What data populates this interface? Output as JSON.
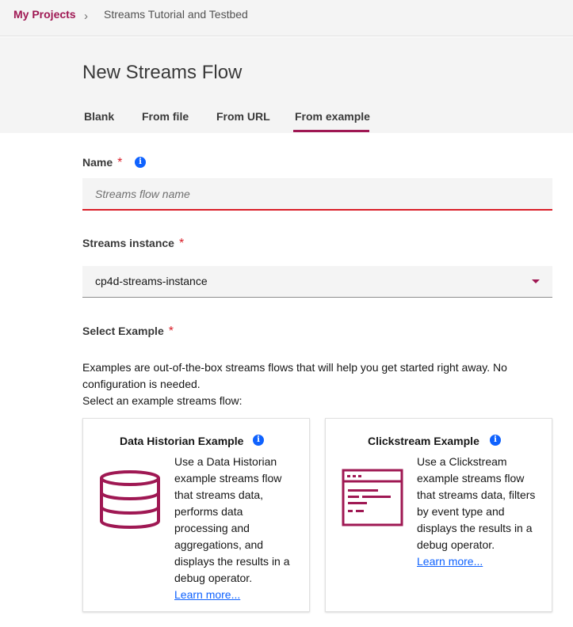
{
  "breadcrumb": {
    "root": "My Projects",
    "separator": "›",
    "current": "Streams Tutorial and Testbed"
  },
  "header": {
    "title": "New Streams Flow",
    "tabs": [
      {
        "label": "Blank",
        "selected": false
      },
      {
        "label": "From file",
        "selected": false
      },
      {
        "label": "From URL",
        "selected": false
      },
      {
        "label": "From example",
        "selected": true
      }
    ]
  },
  "form": {
    "name": {
      "label": "Name",
      "required_mark": "*",
      "info_icon": "i",
      "value": "",
      "placeholder": "Streams flow name"
    },
    "instance": {
      "label": "Streams instance",
      "required_mark": "*",
      "value": "cp4d-streams-instance"
    },
    "example": {
      "label": "Select Example",
      "required_mark": "*",
      "description": "Examples are out-of-the-box streams flows that will help you get started right away. No configuration is needed.",
      "prompt": "Select an example streams flow:",
      "cards": [
        {
          "title": "Data Historian Example",
          "info_icon": "i",
          "icon": "database-icon",
          "text": "Use a Data Historian example streams flow that streams data, performs data processing and aggregations, and displays the results in a debug operator.",
          "link": "Learn more..."
        },
        {
          "title": "Clickstream Example",
          "info_icon": "i",
          "icon": "browser-window-icon",
          "text": "Use a Clickstream example streams flow that streams data, filters by event type and displays the results in a debug operator.",
          "link": "Learn more..."
        }
      ]
    }
  },
  "colors": {
    "accent": "#9f1853",
    "error": "#da1e28",
    "info": "#0f62fe",
    "link": "#0f62fe",
    "header_bg": "#f4f4f4"
  }
}
